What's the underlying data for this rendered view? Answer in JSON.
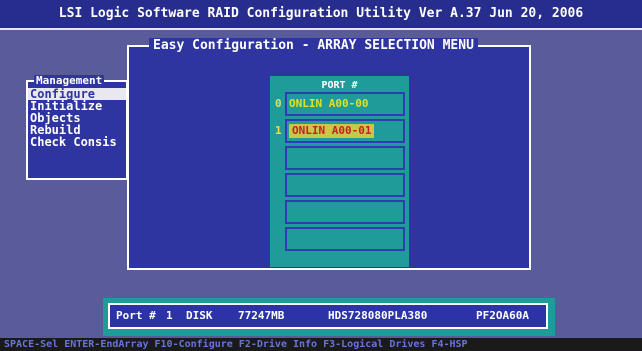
{
  "window": {
    "title": "LSI Logic Software RAID Configuration Utility Ver A.37 Jun 20, 2006"
  },
  "management_menu": {
    "title": "Management",
    "items": [
      "Configure",
      "Initialize",
      "Objects",
      "Rebuild",
      "Check Consis"
    ],
    "selected_index": 0
  },
  "easy_config": {
    "title": "Easy Configuration - ARRAY SELECTION MENU",
    "port_header": "PORT #",
    "slots": [
      {
        "index": "0",
        "label": "ONLIN A00-00",
        "selected": false
      },
      {
        "index": "1",
        "label": "ONLIN A00-01",
        "selected": true
      },
      {
        "index": "",
        "label": "",
        "selected": false
      },
      {
        "index": "",
        "label": "",
        "selected": false
      },
      {
        "index": "",
        "label": "",
        "selected": false
      },
      {
        "index": "",
        "label": "",
        "selected": false
      }
    ]
  },
  "drive_info": {
    "port_label": "Port #",
    "port_value": "1",
    "type": "DISK",
    "size": "77247MB",
    "model": "HDS728080PLA380",
    "firmware": "PF2OA60A"
  },
  "status_bar": {
    "text": "SPACE-Sel ENTER-EndArray F10-Configure F2-Drive Info F3-Logical Drives F4-HSP"
  },
  "colors": {
    "background": "#5a5b9a",
    "title_bar": "#272d8c",
    "panel": "#2e34a0",
    "port_panel": "#1f9c9a",
    "slot_text": "#e0e024",
    "selected_slot_bg": "#c8c848",
    "selected_slot_text": "#c82020",
    "status_text": "#6a74d8"
  }
}
